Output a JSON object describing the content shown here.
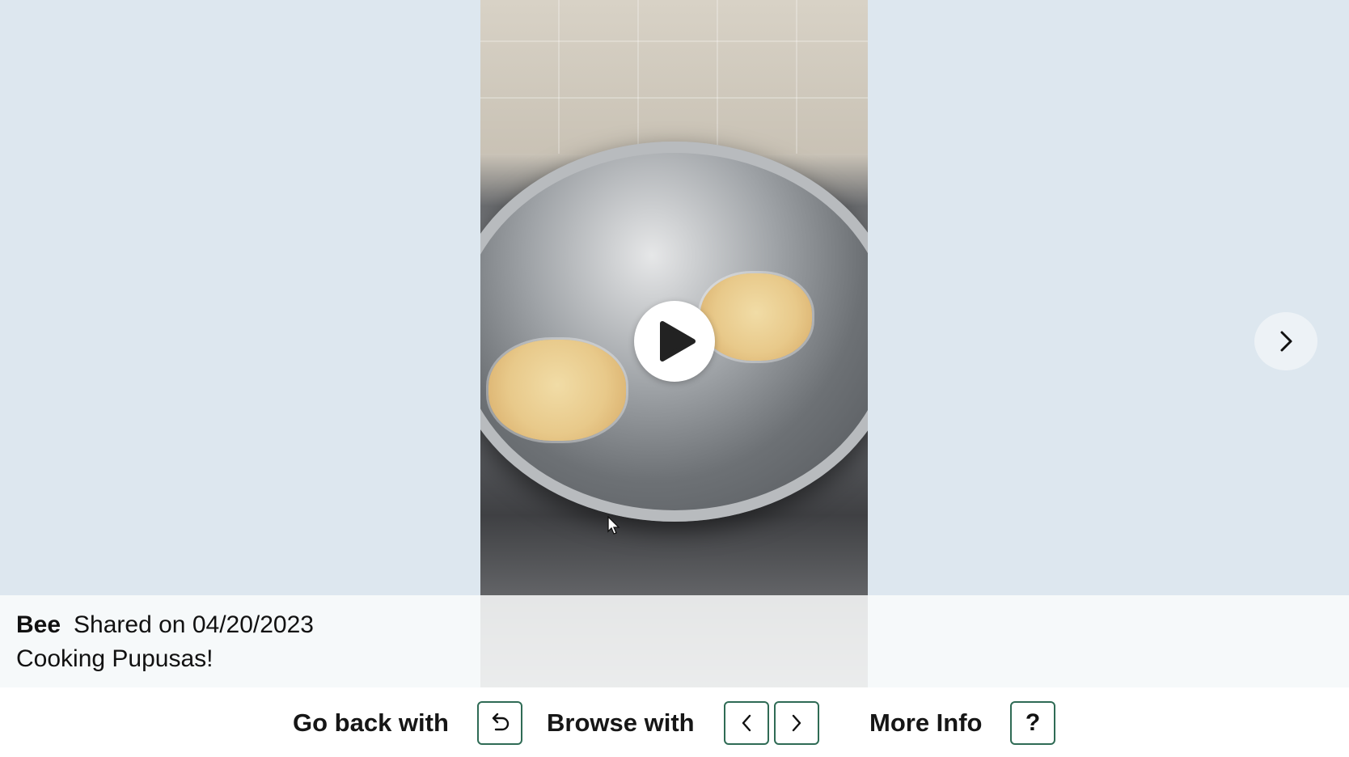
{
  "post": {
    "author": "Bee",
    "shared_text": "Shared on 04/20/2023",
    "caption": "Cooking Pupusas!"
  },
  "video": {
    "state": "paused",
    "subject": "pupusas frying in a pan"
  },
  "controls": {
    "play_icon": "play-icon",
    "next_icon": "chevron-right-icon"
  },
  "help": {
    "go_back_label": "Go back with",
    "go_back_key_icon": "undo-arrow-icon",
    "browse_label": "Browse with",
    "browse_key_icons": [
      "chevron-left-icon",
      "chevron-right-icon"
    ],
    "more_info_label": "More Info",
    "more_info_key": "?"
  },
  "colors": {
    "background": "#dde7ef",
    "key_border": "#2f6b55",
    "help_bar": "#ffffff"
  }
}
